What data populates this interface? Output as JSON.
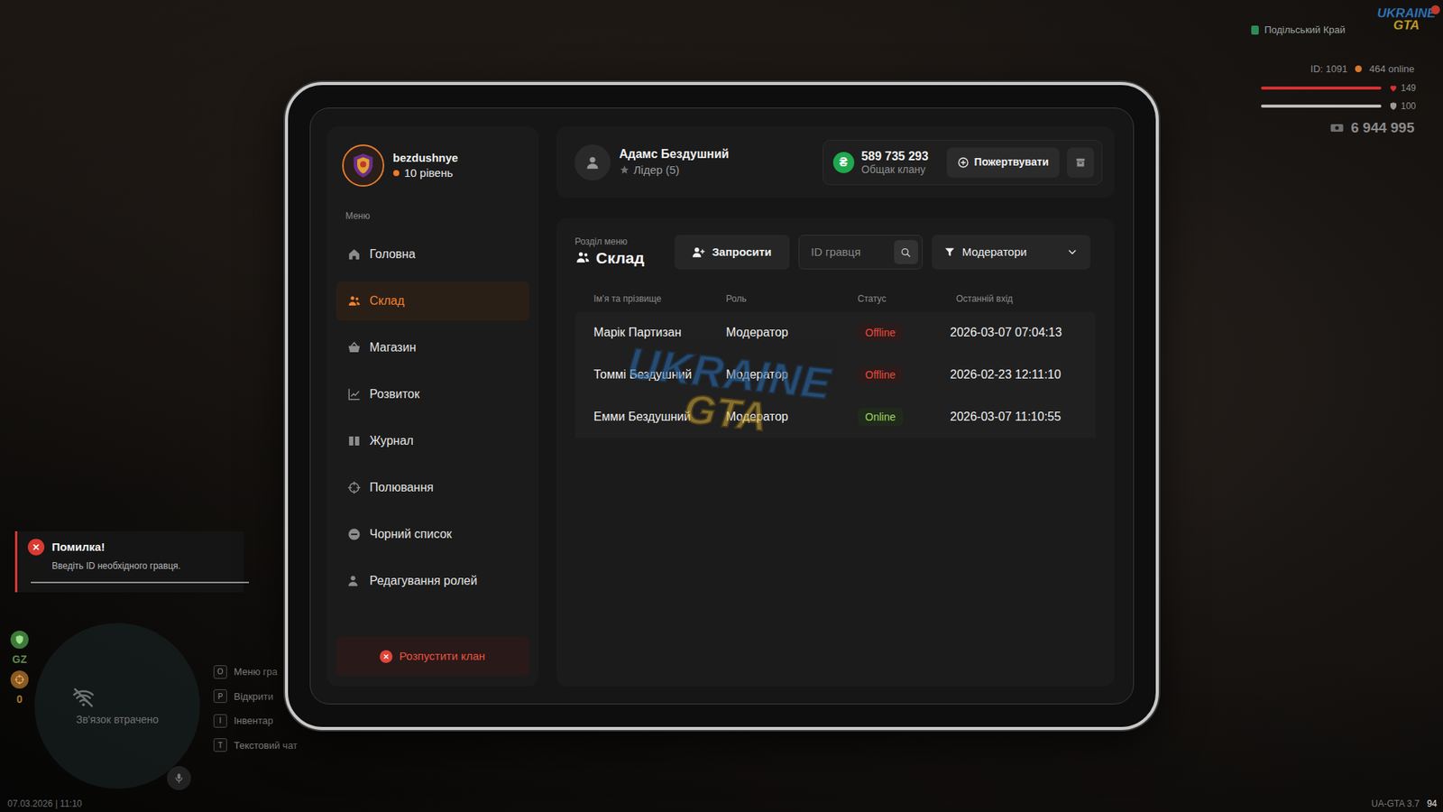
{
  "hud": {
    "server": "Подільський Край",
    "logo": {
      "top": "UKRAINE",
      "bottom": "GTA"
    },
    "player_id": "ID: 1091",
    "online": "464 online",
    "health": {
      "value": "149",
      "level": 1
    },
    "armor": {
      "value": "100",
      "level": 1
    },
    "money": "6 944 995",
    "zone": "GZ",
    "wanted": "0",
    "radar": "Зв'язок втрачено",
    "hints": [
      {
        "key": "O",
        "label": "Меню гра"
      },
      {
        "key": "P",
        "label": "Відкрити"
      },
      {
        "key": "I",
        "label": "Інвентар"
      },
      {
        "key": "T",
        "label": "Текстовий чат"
      }
    ],
    "datetime": "07.03.2026 | 11:10",
    "version": "UA-GTA 3.7",
    "fps": "94"
  },
  "toast": {
    "title": "Помилка!",
    "message": "Введіть ID необхідного гравця."
  },
  "tablet": {
    "clan": {
      "name": "bezdushnye",
      "level": "10 рівень"
    },
    "menu_label": "Меню",
    "sidebar": {
      "items": [
        {
          "label": "Головна",
          "selected": false
        },
        {
          "label": "Склад",
          "selected": true
        },
        {
          "label": "Магазин",
          "selected": false
        },
        {
          "label": "Розвиток",
          "selected": false
        },
        {
          "label": "Журнал",
          "selected": false
        },
        {
          "label": "Полювання",
          "selected": false
        },
        {
          "label": "Чорний список",
          "selected": false
        },
        {
          "label": "Редагування ролей",
          "selected": false
        }
      ]
    },
    "disband_button": "Розпустити клан",
    "leader": {
      "name": "Адамс Бездушний",
      "role": "Лідер (5)"
    },
    "bank": {
      "currency": "₴",
      "amount": "589 735 293",
      "label": "Общак клану",
      "donate_button": "Пожертвувати"
    },
    "section": {
      "caption": "Розділ меню",
      "title": "Склад"
    },
    "invite_button": "Запросити",
    "search": {
      "placeholder": "ID гравця"
    },
    "filter": {
      "value": "Модератори",
      "expanded": false
    },
    "table": {
      "columns": [
        "Ім'я та прізвище",
        "Роль",
        "Статус",
        "Останній вхід"
      ],
      "rows": [
        {
          "cells": [
            "Марік Партизан",
            "Модератор",
            "Offline",
            "2026-03-07 07:04:13"
          ],
          "online": false
        },
        {
          "cells": [
            "Томмі Бездушний",
            "Модератор",
            "Offline",
            "2026-02-23 12:11:10"
          ],
          "online": false
        },
        {
          "cells": [
            "Емми Бездушний",
            "Модератор",
            "Online",
            "2026-03-07 11:10:55"
          ],
          "online": true
        }
      ]
    },
    "watermark": {
      "top": "UKRAINE",
      "bottom": "GTA"
    }
  }
}
